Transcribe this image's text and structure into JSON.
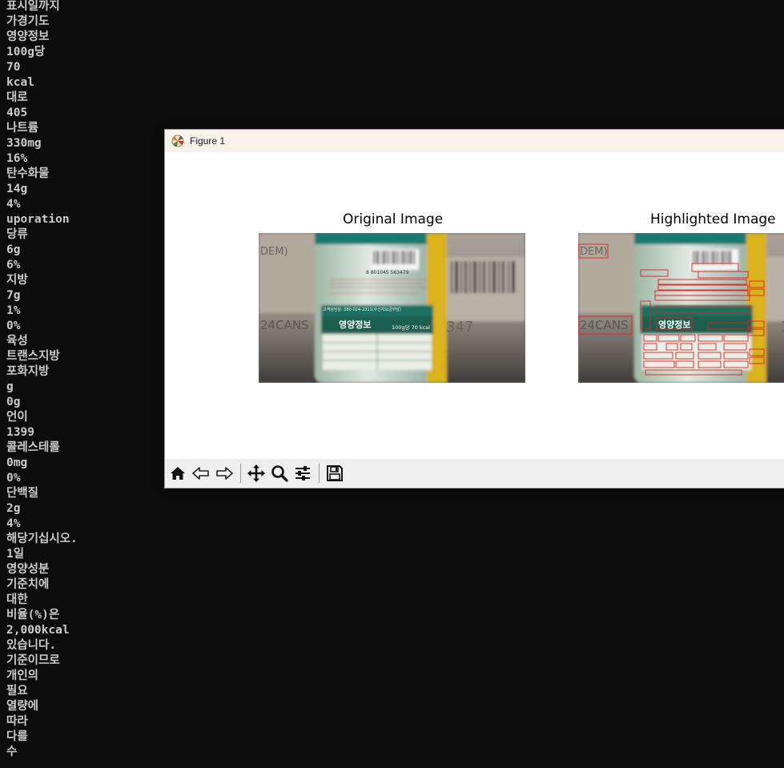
{
  "terminal": {
    "lines": [
      "표시일까지",
      "가경기도",
      "영양정보",
      "100g당",
      "70",
      "kcal",
      "대로",
      "405",
      "나트륨",
      "330mg",
      "16%",
      "탄수화물",
      "14g",
      "4%",
      "uporation",
      "당류",
      "6g",
      "6%",
      "지방",
      "7g",
      "1%",
      "0%",
      "육성",
      "트랜스지방",
      "포화지방",
      "g",
      "0g",
      "언이",
      "1399",
      "콜레스테롤",
      "0mg",
      "0%",
      "단백질",
      "2g",
      "4%",
      "해당기십시오.",
      "1일",
      "영양성분",
      "기준치에",
      "대한",
      "비율(%)은",
      "2,000kcal",
      "있습니다.",
      "기준이므로",
      "개인의",
      "필요",
      "열량에",
      "따라",
      "다를",
      "수"
    ]
  },
  "figure_window": {
    "title": "Figure 1",
    "panels": [
      {
        "title": "Original Image",
        "highlighted": false
      },
      {
        "title": "Highlighted Image",
        "highlighted": true
      }
    ],
    "image": {
      "carton_text": "DEM)",
      "carton_text_2": "24CANS",
      "carton_number": "347",
      "barcode_number": "8 801045 563479",
      "label_heading": "영양정보",
      "label_per": "100g당 70 kcal",
      "label_contact": "고객상담실: 080-024-2311(수신자요금부담)"
    },
    "toolbar": {
      "home_icon": "home-icon",
      "back_icon": "back-arrow-icon",
      "forward_icon": "forward-arrow-icon",
      "pan_icon": "pan-move-icon",
      "zoom_icon": "zoom-magnifier-icon",
      "configure_icon": "configure-subplots-icon",
      "save_icon": "save-floppy-icon"
    }
  }
}
